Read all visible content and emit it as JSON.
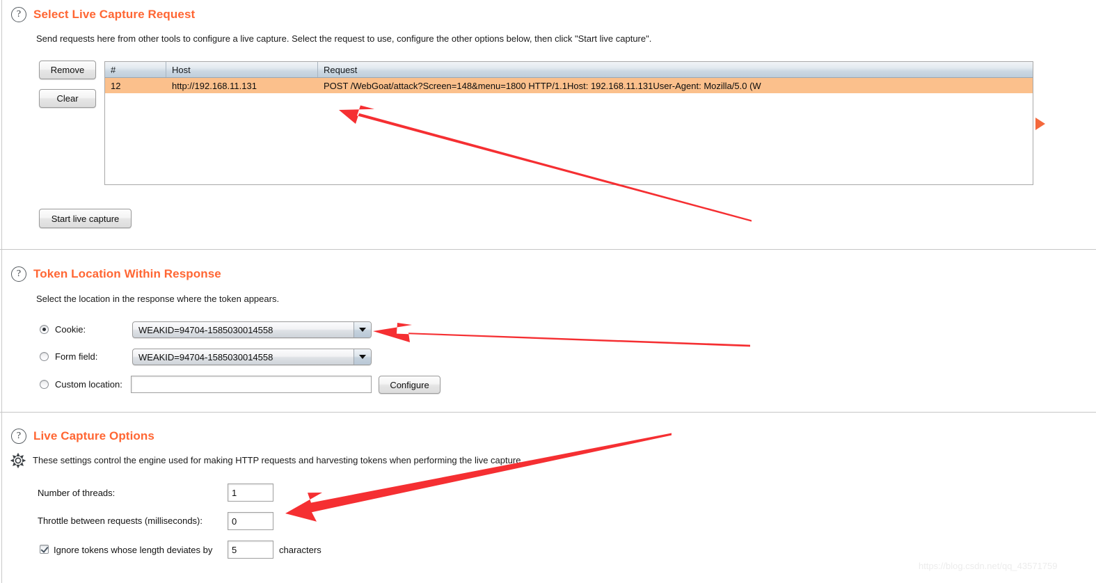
{
  "sections": {
    "live_capture_request": {
      "title": "Select Live Capture Request",
      "help_icon": "question-mark-icon",
      "description": "Send requests here from other tools to configure a live capture. Select the request to use, configure the other options below, then click \"Start live capture\".",
      "buttons": {
        "remove": "Remove",
        "clear": "Clear",
        "start": "Start live capture"
      },
      "table": {
        "columns": [
          "#",
          "Host",
          "Request"
        ],
        "sort_indicator": "ascending-caret-icon",
        "rows": [
          {
            "num": "12",
            "host": "http://192.168.11.131",
            "request": "POST /WebGoat/attack?Screen=148&menu=1800 HTTP/1.1Host: 192.168.11.131User-Agent: Mozilla/5.0 (W",
            "selected": true
          }
        ]
      },
      "marker_icon": "orange-right-triangle-icon"
    },
    "token_location": {
      "title": "Token Location Within Response",
      "help_icon": "question-mark-icon",
      "description": "Select the location in the response where the token appears.",
      "options": [
        {
          "label": "Cookie:",
          "selected": true,
          "value": "WEAKID=94704-1585030014558",
          "control": "combobox"
        },
        {
          "label": "Form field:",
          "selected": false,
          "value": "WEAKID=94704-1585030014558",
          "control": "combobox"
        },
        {
          "label": "Custom location:",
          "selected": false,
          "value": "",
          "control": "textfield"
        }
      ],
      "configure_button": "Configure"
    },
    "live_capture_options": {
      "title": "Live Capture Options",
      "help_icon": "question-mark-icon",
      "gear_icon": "gear-icon",
      "description": "These settings control the engine used for making HTTP requests and harvesting tokens when performing the live capture.",
      "fields": [
        {
          "label": "Number of threads:",
          "value": "1"
        },
        {
          "label": "Throttle between requests (milliseconds):",
          "value": "0"
        }
      ],
      "ignore_tokens": {
        "checked": true,
        "label_before": "Ignore tokens whose length deviates by",
        "value": "5",
        "label_after": "characters"
      }
    }
  },
  "annotations": {
    "arrow_color": "#f52f32",
    "arrow_count": 3
  },
  "watermark": "https://blog.csdn.net/qq_43571759",
  "colors": {
    "heading": "#ff6633",
    "selected_row": "#fbc08c",
    "table_header": "#cbd7e2",
    "marker": "#f4683c"
  }
}
